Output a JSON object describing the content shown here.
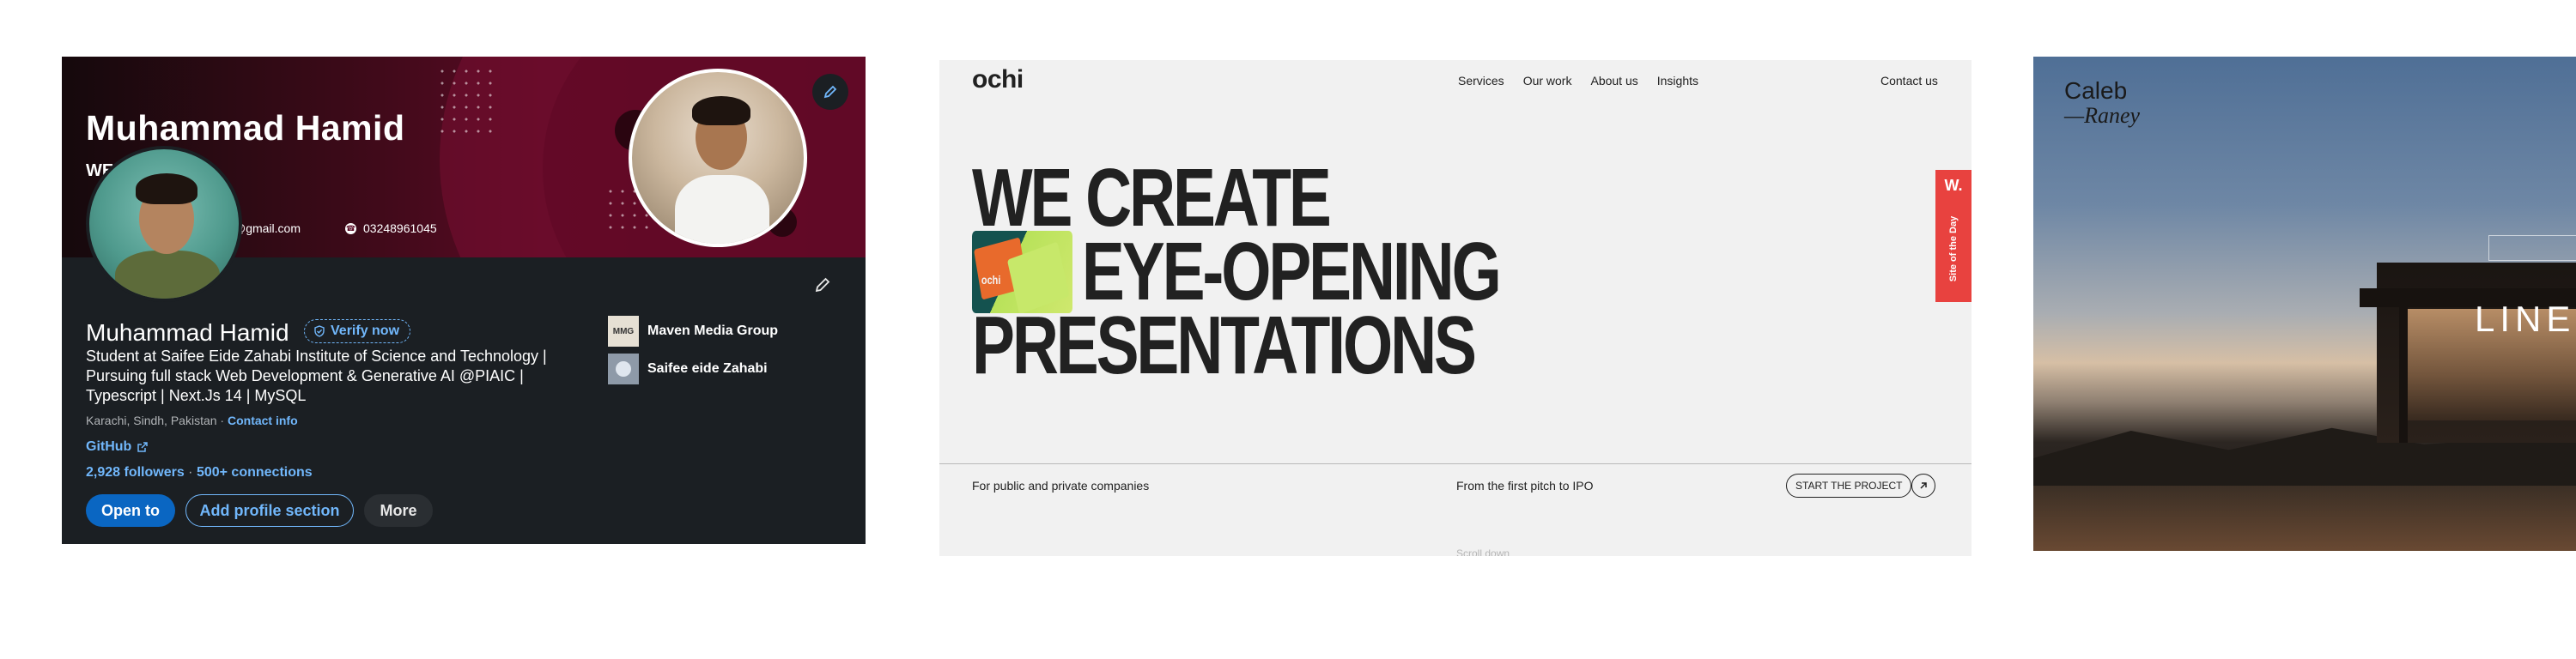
{
  "linkedin": {
    "banner_title": "Muhammad Hamid",
    "banner_subtitle_truncated": "WE",
    "banner_email_partial": "@gmail.com",
    "banner_phone": "03248961045",
    "name": "Muhammad Hamid",
    "verify_label": "Verify now",
    "headline": "Student at Saifee Eide Zahabi Institute of Science and Technology | Pursuing full stack Web Development & Generative AI @PIAIC | Typescript | Next.Js 14 | MySQL",
    "location": "Karachi, Sindh, Pakistan",
    "location_separator": " · ",
    "contact_info_label": "Contact info",
    "github_label": "GitHub",
    "followers_label": "2,928 followers",
    "network_separator": " · ",
    "connections_label": "500+ connections",
    "buttons": {
      "open_to": "Open to",
      "add_section": "Add profile section",
      "more": "More"
    },
    "experience": [
      {
        "name": "Maven Media Group",
        "logo_text": "MMG"
      },
      {
        "name": "Saifee eide Zahabi",
        "logo_text": ""
      }
    ],
    "colors": {
      "banner": "#5a0a24",
      "card_bg": "#1b1f23",
      "link": "#71b7fb",
      "primary_button": "#0a66c2"
    }
  },
  "ochi": {
    "logo": "ochi",
    "nav": [
      "Services",
      "Our work",
      "About us",
      "Insights"
    ],
    "contact": "Contact us",
    "hero": [
      "WE CREATE",
      "EYE-OPENING",
      "PRESENTATIONS"
    ],
    "thumb_labels": [
      "ochi",
      "ochi"
    ],
    "footer_left": "For public and private companies",
    "footer_mid": "From the first pitch to IPO",
    "cta": "START THE PROJECT",
    "arrow_icon": "arrow-up-right",
    "scroll_hint": "Scroll down",
    "sotd_badge": "W.",
    "sotd_text": "Site of the Day",
    "colors": {
      "bg": "#f1f1f1",
      "text": "#212121",
      "badge": "#e8423f"
    }
  },
  "caleb": {
    "logo_line1": "Caleb",
    "logo_line2": "—Raney",
    "title_partial": "LINE"
  }
}
